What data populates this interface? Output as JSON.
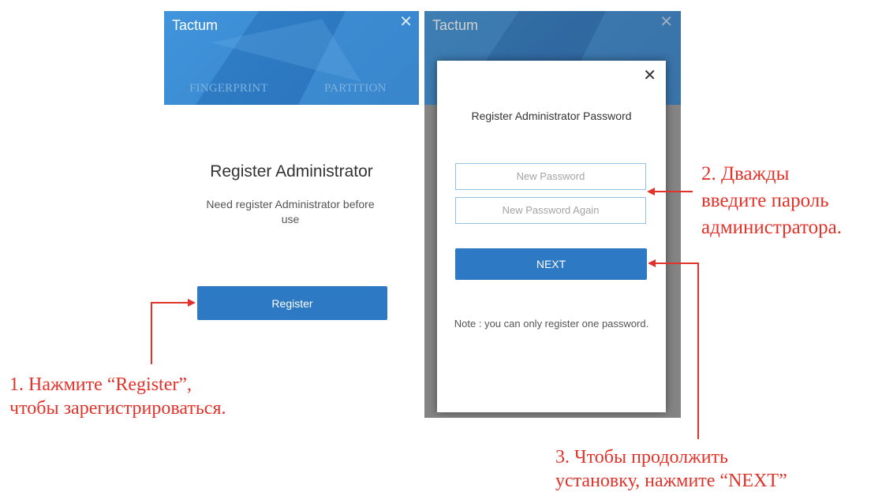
{
  "left_window": {
    "title": "Tactum",
    "tabs": [
      "FINGERPRINT",
      "PARTITION"
    ],
    "heading": "Register Administrator",
    "description": "Need register Administrator before use",
    "register_button": "Register"
  },
  "right_window": {
    "title": "Tactum",
    "modal": {
      "close": "✕",
      "title": "Register Administrator Password",
      "new_password_placeholder": "New Password",
      "new_password_again_placeholder": "New Password Again",
      "next_button": "NEXT",
      "note": "Note : you can only register one password."
    }
  },
  "annotations": {
    "step1_line1": "1. Нажмите “Register”,",
    "step1_line2": "чтобы зарегистрироваться.",
    "step2_line1": "2. Дважды",
    "step2_line2": "введите пароль",
    "step2_line3": "администратора.",
    "step3_line1": "3. Чтобы продолжить",
    "step3_line2": "установку, нажмите “NEXT”"
  },
  "colors": {
    "accent": "#2e79c4",
    "banner": "#3a8fd6",
    "annotation": "#e2332b"
  }
}
